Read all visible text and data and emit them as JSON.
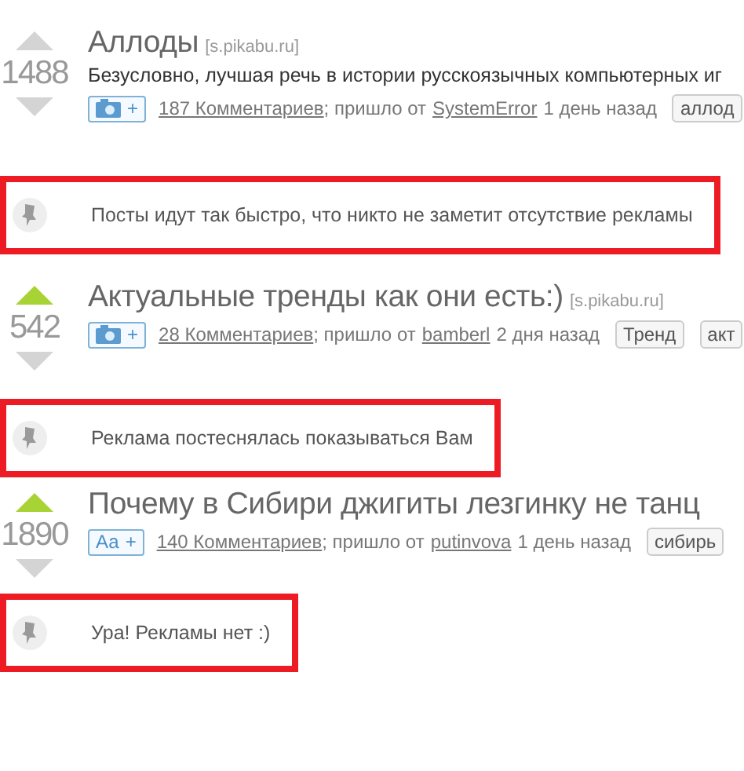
{
  "feed": [
    {
      "kind": "post",
      "upvoted": false,
      "rating": "1488",
      "title": "Аллоды",
      "source": "[s.pikabu.ru]",
      "description": "Безусловно, лучшая речь в истории русскоязычных компьютерных иг",
      "badge": {
        "kind": "photo",
        "plus": "+"
      },
      "comments": "187 Комментариев",
      "from_label": "; пришло от",
      "author": "SystemError",
      "time": "1 день назад",
      "tags": [
        "аллод"
      ]
    },
    {
      "kind": "notice",
      "text": "Посты идут так быстро, что никто не заметит отсутствие рекламы"
    },
    {
      "kind": "post",
      "upvoted": true,
      "rating": "542",
      "title": "Актуальные тренды как они есть:)",
      "source": "[s.pikabu.ru]",
      "badge": {
        "kind": "photo",
        "plus": "+"
      },
      "comments": "28 Комментариев",
      "from_label": "; пришло от",
      "author": "bamberl",
      "time": "2 дня назад",
      "tags": [
        "Тренд",
        "акт"
      ]
    },
    {
      "kind": "notice",
      "text": "Реклама постеснялась показываться Вам"
    },
    {
      "kind": "post",
      "upvoted": true,
      "rating": "1890",
      "title": "Почему в Сибири джигиты лезгинку не танц",
      "badge": {
        "kind": "text",
        "label": "Аа",
        "plus": "+"
      },
      "comments": "140 Комментариев",
      "from_label": "; пришло от",
      "author": "putinvova",
      "time": "1 день назад",
      "tags": [
        "сибирь"
      ]
    },
    {
      "kind": "notice",
      "text": "Ура! Рекламы нет :)"
    }
  ]
}
